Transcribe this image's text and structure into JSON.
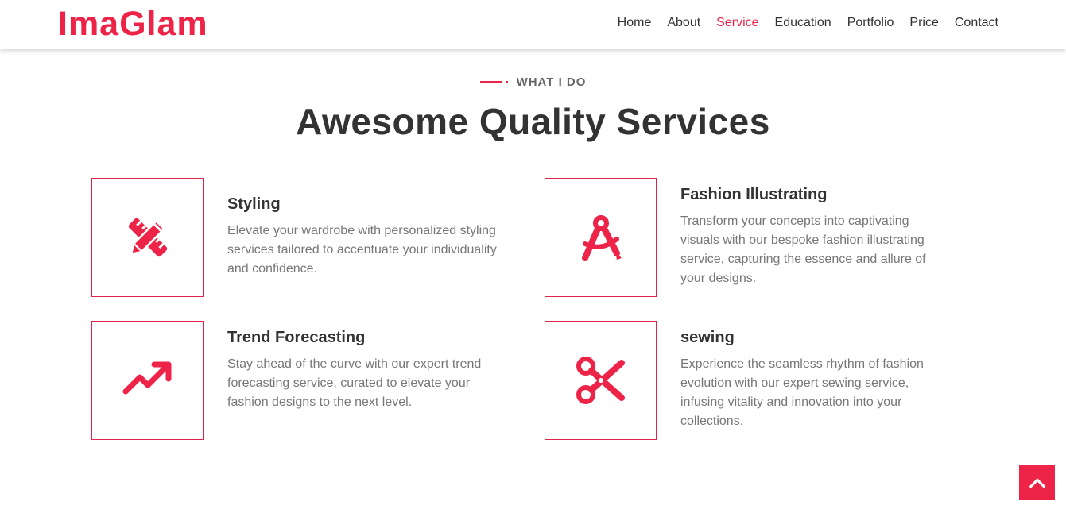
{
  "brand": {
    "name": "ImaGlam"
  },
  "nav": {
    "items": [
      {
        "label": "Home"
      },
      {
        "label": "About"
      },
      {
        "label": "Service"
      },
      {
        "label": "Education"
      },
      {
        "label": "Portfolio"
      },
      {
        "label": "Price"
      },
      {
        "label": "Contact"
      }
    ],
    "active": "Service"
  },
  "section": {
    "eyebrow": "WHAT I DO",
    "title": "Awesome Quality Services"
  },
  "services": [
    {
      "icon": "pencil-ruler-icon",
      "title": "Styling",
      "description": "Elevate your wardrobe with personalized styling services tailored to accentuate your individuality and confidence."
    },
    {
      "icon": "compass-drafting-icon",
      "title": "Fashion Illustrating",
      "description": "Transform your concepts into captivating visuals with our bespoke fashion illustrating service, capturing the essence and allure of your designs."
    },
    {
      "icon": "trend-up-arrow-icon",
      "title": "Trend Forecasting",
      "description": "Stay ahead of the curve with our expert trend forecasting service, curated to elevate your fashion designs to the next level."
    },
    {
      "icon": "scissors-icon",
      "title": "sewing",
      "description": "Experience the seamless rhythm of fashion evolution with our expert sewing service, infusing vitality and innovation into your collections."
    }
  ],
  "colors": {
    "accent": "#ee2348",
    "text": "#333333",
    "muted": "#777777"
  }
}
